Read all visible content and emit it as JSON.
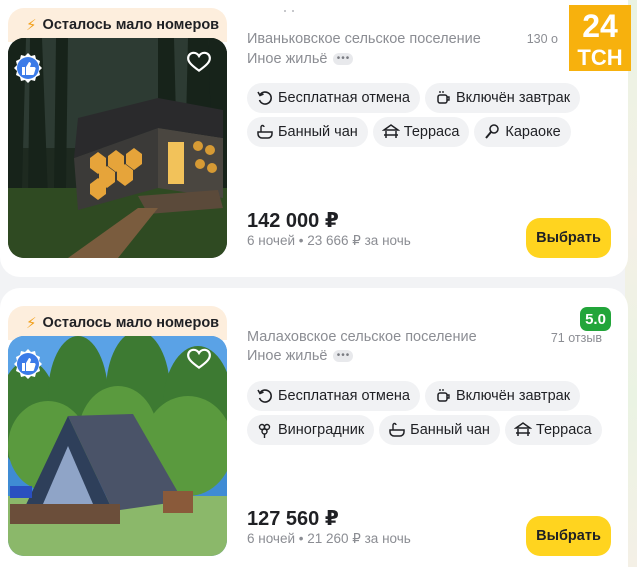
{
  "logo": {
    "text_top": "24",
    "text_bottom": "ТСН"
  },
  "listings": [
    {
      "badge": "Осталось мало номеров",
      "location": "Иваньковское сельское поселение",
      "type": "Иное жильё",
      "reviews": "130 о",
      "chips": [
        {
          "icon": "cancel-icon",
          "label": "Бесплатная отмена"
        },
        {
          "icon": "breakfast-icon",
          "label": "Включён завтрак"
        },
        {
          "icon": "bath-tub-icon",
          "label": "Банный чан"
        },
        {
          "icon": "terrace-icon",
          "label": "Терраса"
        },
        {
          "icon": "karaoke-icon",
          "label": "Караоке"
        }
      ],
      "price": "142 000 ₽",
      "sub_price": "6 ночей • 23 666 ₽ за ночь",
      "button": "Выбрать"
    },
    {
      "badge": "Осталось мало номеров",
      "location": "Малаховское сельское поселение",
      "type": "Иное жильё",
      "rating": "5.0",
      "reviews": "71 отзыв",
      "chips": [
        {
          "icon": "cancel-icon",
          "label": "Бесплатная отмена"
        },
        {
          "icon": "breakfast-icon",
          "label": "Включён завтрак"
        },
        {
          "icon": "vineyard-icon",
          "label": "Виноградник"
        },
        {
          "icon": "bath-tub-icon",
          "label": "Банный чан"
        },
        {
          "icon": "terrace-icon",
          "label": "Терраса"
        }
      ],
      "price": "127 560 ₽",
      "sub_price": "6 ночей • 21 260 ₽ за ночь",
      "button": "Выбрать"
    }
  ],
  "colors": {
    "accent": "#ffd41f",
    "rating": "#22a53a",
    "badge_bg": "#fdeedd",
    "logo": "#f7b10d"
  }
}
